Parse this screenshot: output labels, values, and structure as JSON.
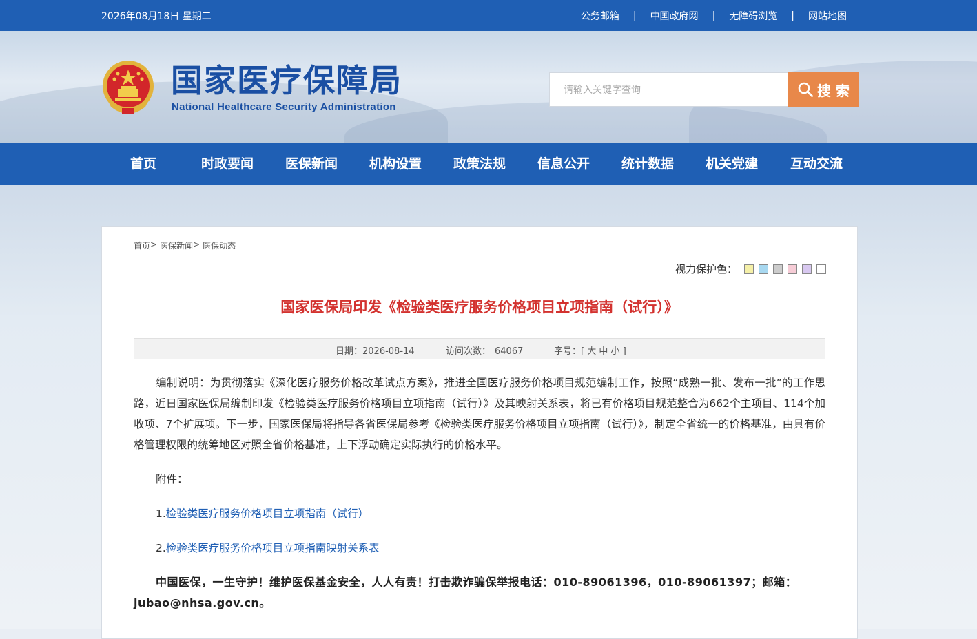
{
  "topbar": {
    "date": "2026年08月18日 星期二",
    "links": [
      "公务邮箱",
      "中国政府网",
      "无障碍浏览",
      "网站地图"
    ],
    "separator": "|"
  },
  "header": {
    "title_cn": "国家医疗保障局",
    "title_en": "National Healthcare Security Administration",
    "search_placeholder": "请输入关键字查询",
    "search_button": "搜 索"
  },
  "nav": {
    "items": [
      "首页",
      "时政要闻",
      "医保新闻",
      "机构设置",
      "政策法规",
      "信息公开",
      "统计数据",
      "机关党建",
      "互动交流"
    ]
  },
  "breadcrumb": {
    "items": [
      "首页",
      "医保新闻",
      "医保动态"
    ],
    "separator": ">"
  },
  "vision": {
    "label": "视力保护色：",
    "colors": [
      "#f5f0a8",
      "#a8d8f0",
      "#cccccc",
      "#f6ccd6",
      "#d8c8f0",
      "#ffffff"
    ]
  },
  "article": {
    "title": "国家医保局印发《检验类医疗服务价格项目立项指南（试行）》",
    "date_label": "日期：",
    "date": "2026-08-14",
    "visits_label": "访问次数：",
    "visits": "64067",
    "font_label": "字号：",
    "font_open": "[",
    "font_large": "大",
    "font_medium": "中",
    "font_small": "小",
    "font_close": "]",
    "paragraph": "编制说明：为贯彻落实《深化医疗服务价格改革试点方案》，推进全国医疗服务价格项目规范编制工作，按照“成熟一批、发布一批”的工作思路，近日国家医保局编制印发《检验类医疗服务价格项目立项指南（试行）》及其映射关系表，将已有价格项目规范整合为662个主项目、114个加收项、7个扩展项。下一步，国家医保局将指导各省医保局参考《检验类医疗服务价格项目立项指南（试行）》，制定全省统一的价格基准，由具有价格管理权限的统筹地区对照全省价格基准，上下浮动确定实际执行的价格水平。",
    "attachment_label": "附件：",
    "attachment1_num": "1.",
    "attachment1": "检验类医疗服务价格项目立项指南（试行）",
    "attachment2_num": "2.",
    "attachment2": "检验类医疗服务价格项目立项指南映射关系表",
    "footer": "中国医保，一生守护！维护医保基金安全，人人有责！打击欺诈骗保举报电话：010-89061396，010-89061397；邮箱：jubao@nhsa.gov.cn。"
  }
}
